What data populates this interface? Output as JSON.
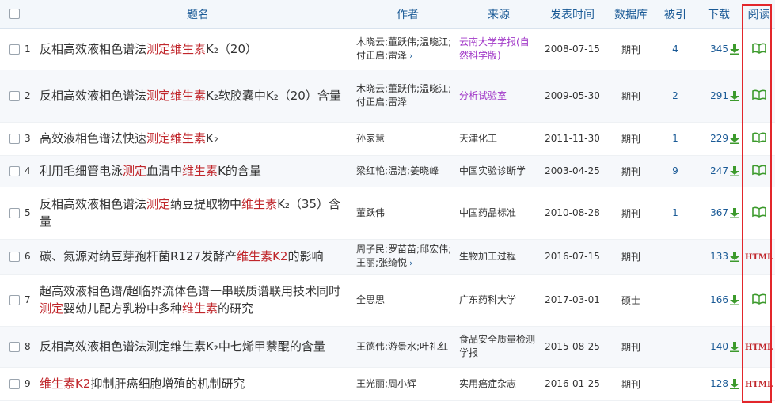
{
  "header": {
    "title": "题名",
    "author": "作者",
    "source": "来源",
    "date": "发表时间",
    "db": "数据库",
    "cite": "被引",
    "download": "下载",
    "read": "阅读"
  },
  "more_icon": "›",
  "rows": [
    {
      "num": "1",
      "title": [
        {
          "t": "反相高效液相色谱法"
        },
        {
          "t": "测定",
          "hl": true
        },
        {
          "t": "维生素",
          "hl": true
        },
        {
          "t": "K₂（20）"
        }
      ],
      "authors": "木晓云;董跃伟;温晓江;付正启;雷泽",
      "more": true,
      "source": "云南大学学报(自然科学版)",
      "source_color": "purple",
      "date": "2008-07-15",
      "db": "期刊",
      "cite": "4",
      "download": "345",
      "read": "book"
    },
    {
      "num": "2",
      "title": [
        {
          "t": "反相高效液相色谱法"
        },
        {
          "t": "测定",
          "hl": true
        },
        {
          "t": "维生素",
          "hl": true
        },
        {
          "t": "K₂软胶囊中K₂（20）含量"
        }
      ],
      "authors": "木晓云;董跃伟;温晓江;付正启;雷泽",
      "more": false,
      "source": "分析试验室",
      "source_color": "purple",
      "date": "2009-05-30",
      "db": "期刊",
      "cite": "2",
      "download": "291",
      "read": "book"
    },
    {
      "num": "3",
      "title": [
        {
          "t": "高效液相色谱法快速"
        },
        {
          "t": "测定",
          "hl": true
        },
        {
          "t": "维生素",
          "hl": true
        },
        {
          "t": "K₂"
        }
      ],
      "authors": "孙家慧",
      "more": false,
      "source": "天津化工",
      "source_color": "",
      "date": "2011-11-30",
      "db": "期刊",
      "cite": "1",
      "download": "229",
      "read": "book"
    },
    {
      "num": "4",
      "title": [
        {
          "t": "利用毛细管电泳"
        },
        {
          "t": "测定",
          "hl": true
        },
        {
          "t": "血清中"
        },
        {
          "t": "维生素",
          "hl": true
        },
        {
          "t": "K的含量"
        }
      ],
      "authors": "梁红艳;温洁;姜晓峰",
      "more": false,
      "source": "中国实验诊断学",
      "source_color": "",
      "date": "2003-04-25",
      "db": "期刊",
      "cite": "9",
      "download": "247",
      "read": "book"
    },
    {
      "num": "5",
      "title": [
        {
          "t": "反相高效液相色谱法"
        },
        {
          "t": "测定",
          "hl": true
        },
        {
          "t": "纳豆提取物中"
        },
        {
          "t": "维生素",
          "hl": true
        },
        {
          "t": "K₂（35）含量"
        }
      ],
      "authors": "董跃伟",
      "more": false,
      "source": "中国药品标准",
      "source_color": "",
      "date": "2010-08-28",
      "db": "期刊",
      "cite": "1",
      "download": "367",
      "read": "book"
    },
    {
      "num": "6",
      "title": [
        {
          "t": "碳、氮源对纳豆芽孢杆菌R127发酵产"
        },
        {
          "t": "维生素K2",
          "hl": true
        },
        {
          "t": "的影响"
        }
      ],
      "authors": "周子民;罗苗苗;邱宏伟;王丽;张绮悦",
      "more": true,
      "source": "生物加工过程",
      "source_color": "",
      "date": "2016-07-15",
      "db": "期刊",
      "cite": "",
      "download": "133",
      "read": "html"
    },
    {
      "num": "7",
      "title": [
        {
          "t": "超高效液相色谱/超临界流体色谱一串联质谱联用技术同时"
        },
        {
          "t": "测定",
          "hl": true
        },
        {
          "t": "婴幼儿配方乳粉中多种"
        },
        {
          "t": "维生素",
          "hl": true
        },
        {
          "t": "的研究"
        }
      ],
      "authors": "全思思",
      "more": false,
      "source": "广东药科大学",
      "source_color": "",
      "date": "2017-03-01",
      "db": "硕士",
      "cite": "",
      "download": "166",
      "read": "book"
    },
    {
      "num": "8",
      "title": [
        {
          "t": "反相高效液相色谱法测定维生素K₂中七烯甲萘醌的含量"
        }
      ],
      "authors": "王德伟;游景水;叶礼红",
      "more": false,
      "source": "食品安全质量检测学报",
      "source_color": "",
      "date": "2015-08-25",
      "db": "期刊",
      "cite": "",
      "download": "140",
      "read": "html"
    },
    {
      "num": "9",
      "title": [
        {
          "t": "维生素K2",
          "hl": true
        },
        {
          "t": "抑制肝癌细胞增殖的机制研究"
        }
      ],
      "authors": "王光丽;周小辉",
      "more": false,
      "source": "实用癌症杂志",
      "source_color": "",
      "date": "2016-01-25",
      "db": "期刊",
      "cite": "",
      "download": "128",
      "read": "html"
    }
  ],
  "html_label": "HTML",
  "colors": {
    "accent": "#1a5a96",
    "highlight": "#c0262b",
    "purple": "#a23ac8",
    "green": "#3c9a2c",
    "frame": "#e3262b"
  }
}
